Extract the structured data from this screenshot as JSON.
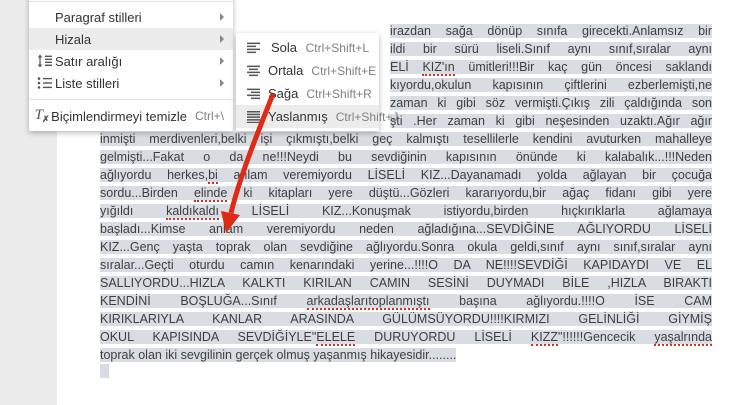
{
  "document": {
    "selection_color": "#d9dde3",
    "text_color": "#3e3e3e",
    "misspell_color": "#e02b1a",
    "lines": [
      {
        "text": "irazdan sağa dönüp sınıfa girecekti.Anlamsız bir",
        "partial": true
      },
      {
        "text": "ildi bir sürü liseli.Sınıf aynı sınıf,sıralar aynı",
        "partial": true
      },
      {
        "text": "ELİ [[KIZ'ın]] ümitleri!!!Bir kaç gün öncesi saklandı",
        "partial": true
      },
      {
        "text": "kıyordu,okulun kapısının çiftlerini ezberlemişti,ne",
        "partial": true
      },
      {
        "text": "zaman ki gibi söz vermişti.Çıkış zili çaldığında son",
        "partial": true
      },
      {
        "text": "şti .Her zaman ki gibi neşesinden uzaktı.Ağır ağır",
        "partial": true
      },
      {
        "text": "inmişti merdivenleri,belki işi çıkmıştı,belki geç kalmıştı tesellilerle kendini avuturken mahalleye",
        "partial": false
      },
      {
        "text": "gelmişti...Fakat o da ne!!!Neydi bu sevdiğinin kapısının önünde ki kalabalık...!!!Neden",
        "partial": false
      },
      {
        "text": "ağlıyordu herkes,[[bi]] anlam veremiyordu LİSELİ KIZ...Dayanamadı yolda ağlayan bir çocuğa",
        "partial": false
      },
      {
        "text": "sordu...Birden [[elinde]] ki kitapları yere düştü...Gözleri kararıyordu,bir ağaç fidanı gibi yere",
        "partial": false
      },
      {
        "text": "yığıldı [[kaldıkaldı]] LİSELİ KIZ...Konuşmak istiyordu,birden hıçkırıklarla ağlamaya",
        "partial": false
      },
      {
        "text": "başladı...Kimse anlam veremiyordu neden ağladığına...SEVDİĞİNE AĞLIYORDU LİSELİ",
        "partial": false
      },
      {
        "text": "KIZ...Genç yaşta toprak olan sevdiğine ağlıyordu.Sonra okula geldi,sınıf aynı sınıf,sıralar aynı",
        "partial": false
      },
      {
        "text": "sıralar...Geçti oturdu camın kenarındaki yerine...!!!!O DA NE!!!!SEVDİĞİ KAPIDAYDI VE EL",
        "partial": false
      },
      {
        "text": "SALLIYORDU...HIZLA KALKTI KIRILAN CAMIN SESİNİ DUYMADI BİLE ,HIZLA BIRAKTI",
        "partial": false
      },
      {
        "text": "KENDİNİ BOŞLUĞA...Sınıf [[arkadaşlarıtoplanmıştı]] başına ağlıyordu.!!!!O İSE CAM",
        "partial": false
      },
      {
        "text": "KIRIKLARIYLA KANLAR ARASINDA GÜLÜMSÜYORDU!!!!KIRMIZI GELİNLİĞİ GİYMİŞ",
        "partial": false
      },
      {
        "text": "OKUL KAPISINDA SEVDİĞİYLE\"[[ELELE]] DURUYORDU LİSELİ [[KIZZ]]\"!!!!!!Gencecik [[yaşalrında]]",
        "partial": false
      },
      {
        "text": "toprak olan iki sevgilinin gerçek olmuş yaşanmış hikayesidir........",
        "partial": false,
        "align": "left"
      }
    ]
  },
  "menus": {
    "main": {
      "items": [
        {
          "label": "Paragraf stilleri",
          "submenu": true
        },
        {
          "label": "Hizala",
          "submenu": true,
          "highlighted": true
        },
        {
          "label": "Satır aralığı",
          "icon": "line-spacing-icon",
          "submenu": true
        },
        {
          "label": "Liste stilleri",
          "icon": "list-styles-icon",
          "submenu": true
        },
        {
          "label": "Biçimlendirmeyi temizle",
          "icon": "clear-formatting-icon",
          "shortcut": "Ctrl+\\"
        }
      ]
    },
    "align_submenu": {
      "items": [
        {
          "label": "Sola",
          "shortcut": "Ctrl+Shift+L",
          "icon": "align-left-icon"
        },
        {
          "label": "Ortala",
          "shortcut": "Ctrl+Shift+E",
          "icon": "align-center-icon"
        },
        {
          "label": "Sağa",
          "shortcut": "Ctrl+Shift+R",
          "icon": "align-right-icon"
        },
        {
          "label": "Yaslanmış",
          "shortcut": "Ctrl+Shift+J",
          "icon": "align-justify-icon",
          "highlighted": true
        }
      ]
    }
  },
  "annotation": {
    "arrow_color": "#df2a16"
  }
}
